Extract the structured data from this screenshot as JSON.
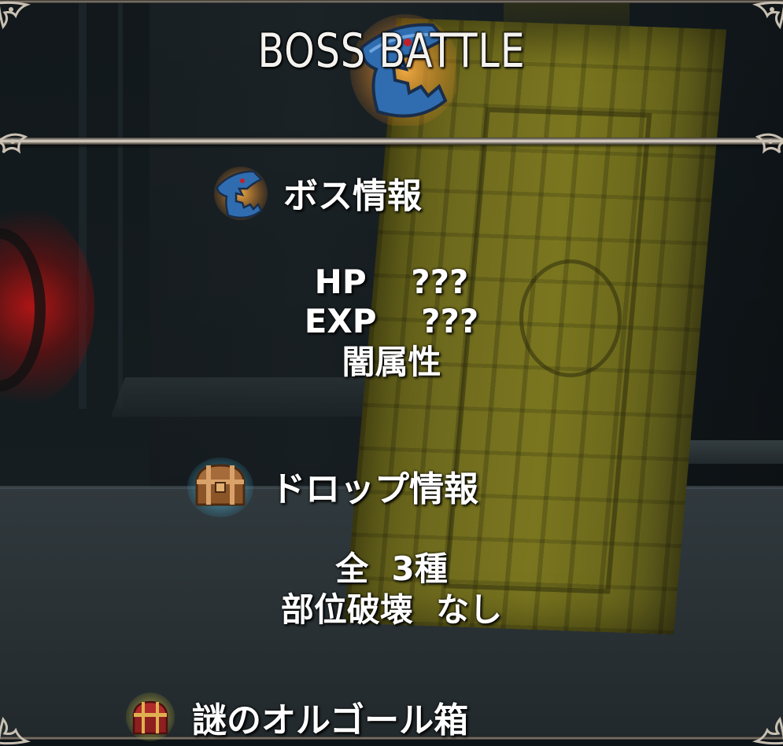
{
  "header": {
    "title": "BOSS BATTLE",
    "title_icon": "shark-head-icon"
  },
  "boss_info": {
    "heading": "ボス情報",
    "icon": "shark-head-icon",
    "hp_line": "HP　 ???",
    "exp_line": "EXP　 ???",
    "attribute": "闇属性"
  },
  "drop_info": {
    "heading": "ドロップ情報",
    "icon": "treasure-chest-icon",
    "count_line": "全  3種",
    "part_break_line": "部位破壊  なし"
  },
  "drop_items": [
    {
      "name": "謎のオルゴール箱",
      "icon": "red-chest-icon"
    }
  ],
  "colors": {
    "text": "#ffffff",
    "shark_blue": "#2f6db0",
    "icon_glow_orange": "#e07a1a",
    "chest_glow_blue": "#5fc6e8",
    "frame_silver": "#b7aea2"
  }
}
